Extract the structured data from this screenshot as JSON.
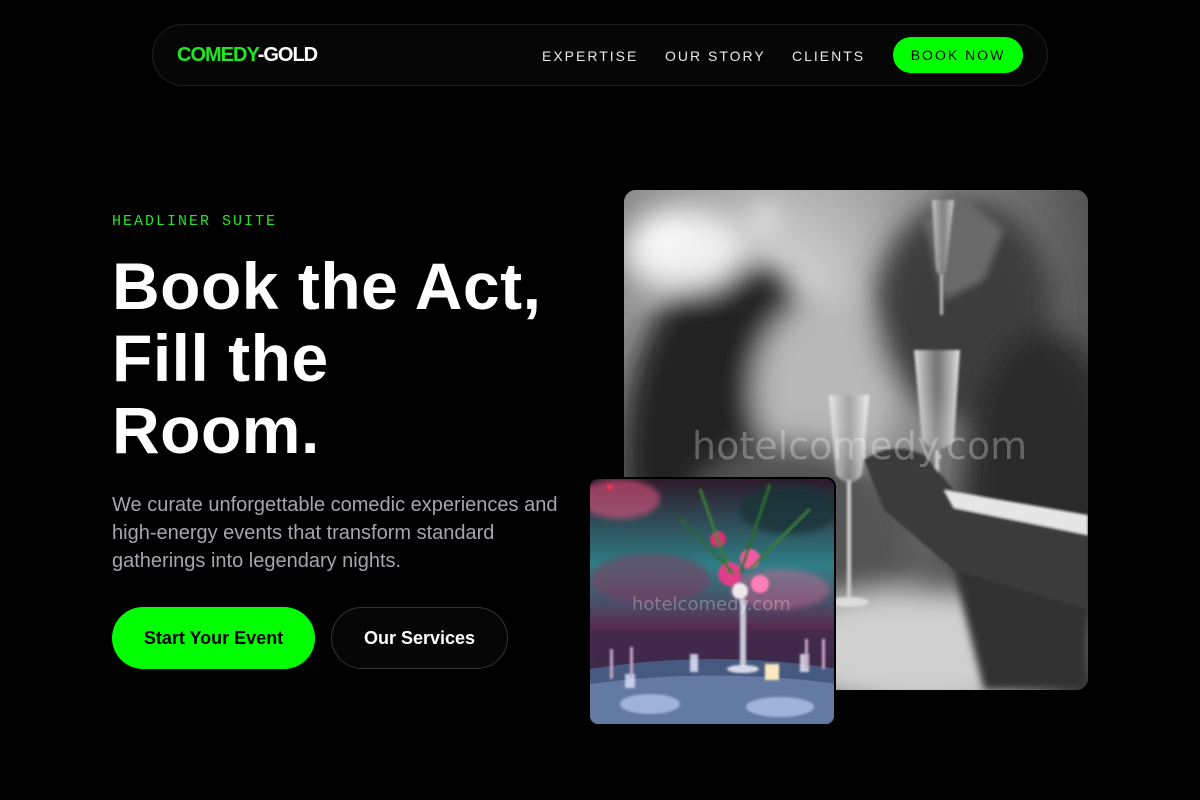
{
  "brand": {
    "part1": "COMEDY",
    "part2": "-GOLD"
  },
  "nav": {
    "links": [
      "EXPERTISE",
      "OUR STORY",
      "CLIENTS"
    ],
    "cta": "BOOK NOW"
  },
  "hero": {
    "eyebrow": "HEADLINER SUITE",
    "headline_lines": [
      "Book the Act,",
      "Fill the",
      "Room."
    ],
    "description": "We curate unforgettable comedic experiences and high-energy events that transform standard gatherings into legendary nights.",
    "primary_cta": "Start Your Event",
    "secondary_cta": "Our Services"
  },
  "images": {
    "main_watermark": "hotelcomedy.com",
    "inset_watermark": "hotelcomedy.com",
    "main_alt": "Guests toasting with champagne glasses (black and white)",
    "inset_alt": "Banquet table with floral centerpiece under pink and blue lighting"
  },
  "colors": {
    "accent": "#00ff00",
    "logo_accent": "#22e622",
    "background": "#000000",
    "body_text": "#a6a6ad"
  }
}
